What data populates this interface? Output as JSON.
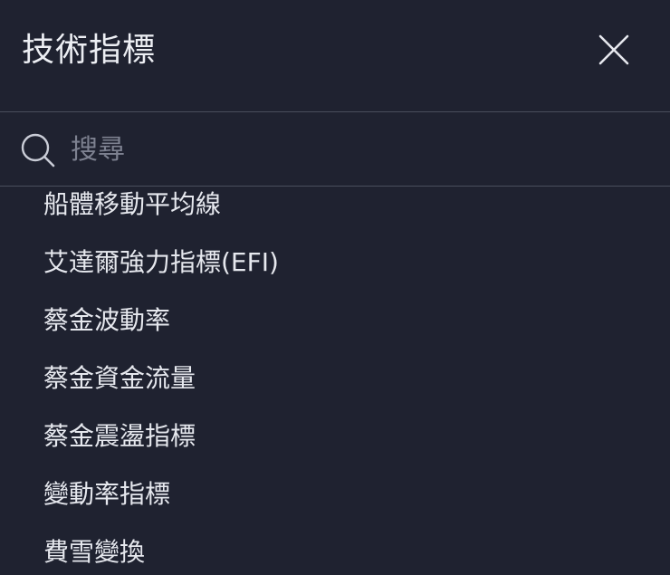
{
  "header": {
    "title": "技術指標",
    "close_icon": "close-icon"
  },
  "search": {
    "placeholder": "搜尋",
    "value": "",
    "icon": "search-icon"
  },
  "indicators": [
    {
      "label": "船體移動平均線"
    },
    {
      "label": "艾達爾強力指標(EFI)"
    },
    {
      "label": "蔡金波動率"
    },
    {
      "label": "蔡金資金流量"
    },
    {
      "label": "蔡金震盪指標"
    },
    {
      "label": "變動率指標"
    },
    {
      "label": "費雪變換"
    }
  ],
  "colors": {
    "background": "#1f2230",
    "text": "#e6e8ee",
    "placeholder": "#7d8190",
    "divider": "#4a4e5c"
  }
}
